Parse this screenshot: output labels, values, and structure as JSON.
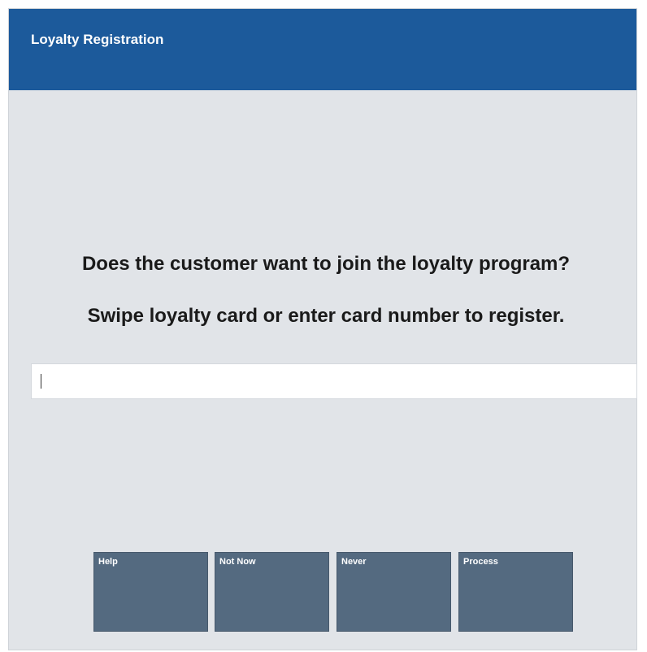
{
  "header": {
    "title": "Loyalty Registration"
  },
  "prompt": {
    "question": "Does the customer want to join the loyalty program?",
    "instruction": "Swipe loyalty card or enter card number to register."
  },
  "card_input": {
    "value": "",
    "placeholder": ""
  },
  "function_keys": [
    {
      "label": "Help"
    },
    {
      "label": "Not Now"
    },
    {
      "label": "Never"
    },
    {
      "label": "Process"
    }
  ],
  "colors": {
    "header_bg": "#1c5a9b",
    "body_bg": "#e1e4e8",
    "button_bg": "#546a80"
  }
}
